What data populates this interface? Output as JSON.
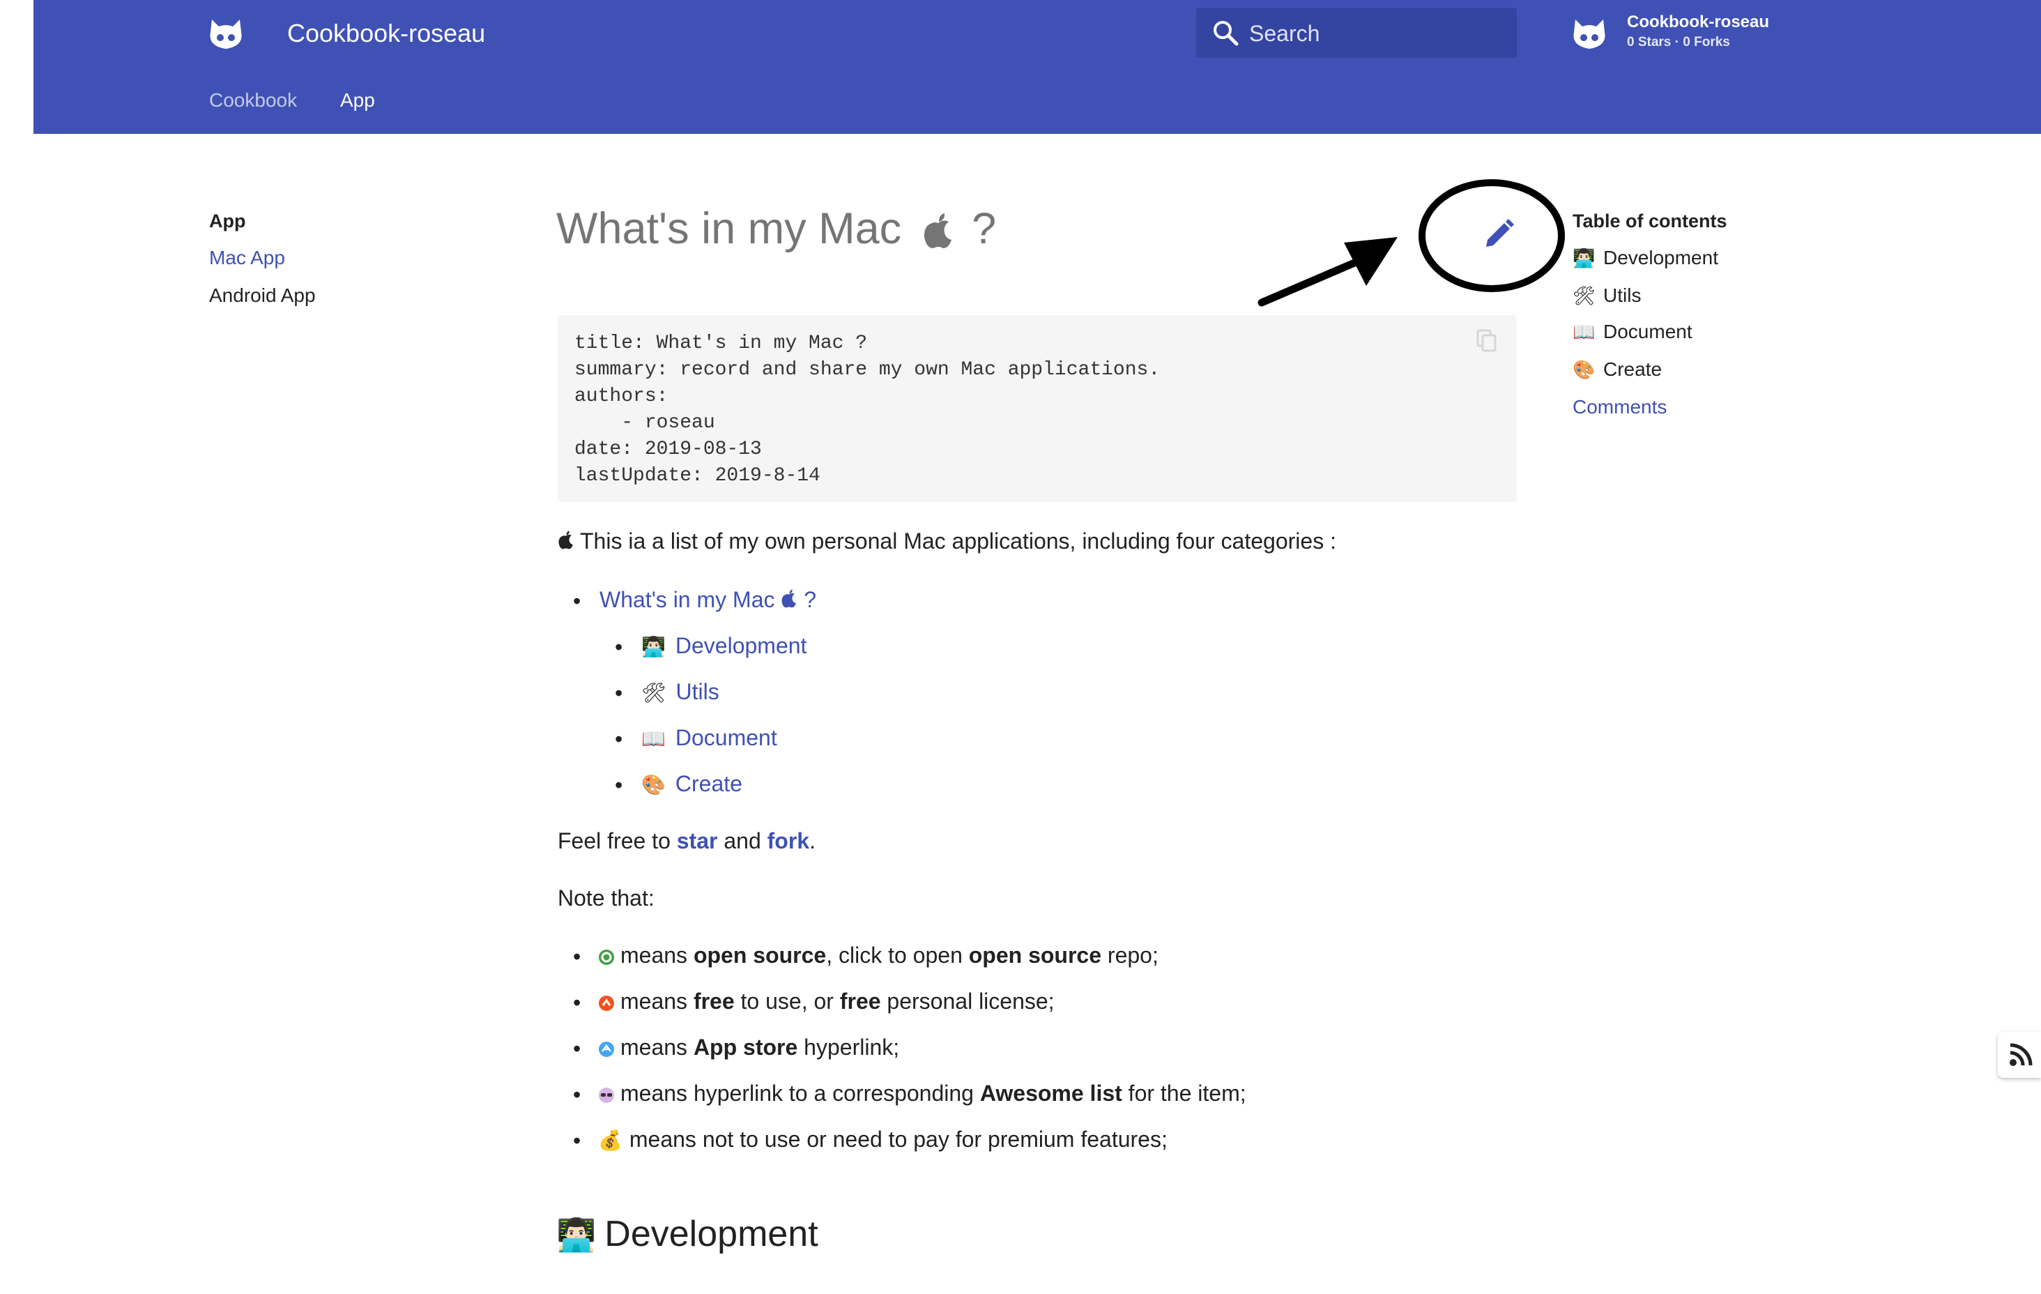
{
  "header": {
    "site_title": "Cookbook-roseau",
    "search_placeholder": "Search",
    "repo_name": "Cookbook-roseau",
    "repo_stats": "0 Stars · 0 Forks",
    "tabs": [
      {
        "label": "Cookbook"
      },
      {
        "label": "App"
      }
    ],
    "color": "#3f51b5"
  },
  "nav": {
    "title": "App",
    "items": [
      {
        "label": "Mac App"
      },
      {
        "label": "Android App"
      }
    ]
  },
  "main": {
    "title": "What's in my Mac",
    "title_suffix": "?",
    "front_matter": [
      "title: What's in my Mac ?",
      "summary: record and share my own Mac applications.",
      "authors:",
      "    - roseau",
      "date: 2019-08-13",
      "lastUpdate: 2019-8-14"
    ],
    "intro": "This ia a list of my own personal Mac applications, including four categories :",
    "outline_link": "What's in my Mac",
    "outline_link_suffix": "?",
    "outline_items": [
      {
        "emoji": "👨🏻‍💻",
        "label": "Development"
      },
      {
        "emoji": "🛠",
        "label": "Utils"
      },
      {
        "emoji": "📖",
        "label": "Document"
      },
      {
        "emoji": "🎨",
        "label": "Create"
      }
    ],
    "feel_free": {
      "before": "Feel free to",
      "star": "star",
      "and": "and",
      "fork": "fork",
      "end": "."
    },
    "note_heading": "Note that:",
    "notes": {
      "open_source": {
        "means": "means",
        "bold1": "open source",
        "mid": ", click to open",
        "bold2": "open source",
        "end": "repo;"
      },
      "free": {
        "means": "means",
        "bold1": "free",
        "mid": "to use, or",
        "bold2": "free",
        "end": "personal license;"
      },
      "app_store": {
        "means": "means",
        "bold1": "App store",
        "end": "hyperlink;"
      },
      "awesome": {
        "pre": "means hyperlink to a corresponding",
        "bold1": "Awesome list",
        "end": "for the item;"
      },
      "paid": {
        "emoji": "💰",
        "text": "means not to use or need to pay for premium features;"
      }
    },
    "section_heading": {
      "emoji": "👨🏻‍💻",
      "text": "Development"
    }
  },
  "toc": {
    "title": "Table of contents",
    "items": [
      {
        "emoji": "👨🏻‍💻",
        "label": "Development"
      },
      {
        "emoji": "🛠",
        "label": "Utils"
      },
      {
        "emoji": "📖",
        "label": "Document"
      },
      {
        "emoji": "🎨",
        "label": "Create"
      }
    ],
    "comments": "Comments"
  },
  "icons": [
    "github-logo-icon",
    "search-icon",
    "apple-icon",
    "edit-pencil-icon",
    "copy-icon",
    "rss-icon"
  ],
  "colors": {
    "accent": "#3f51b5",
    "code_bg": "#f5f5f5",
    "title_gray": "#757575"
  }
}
